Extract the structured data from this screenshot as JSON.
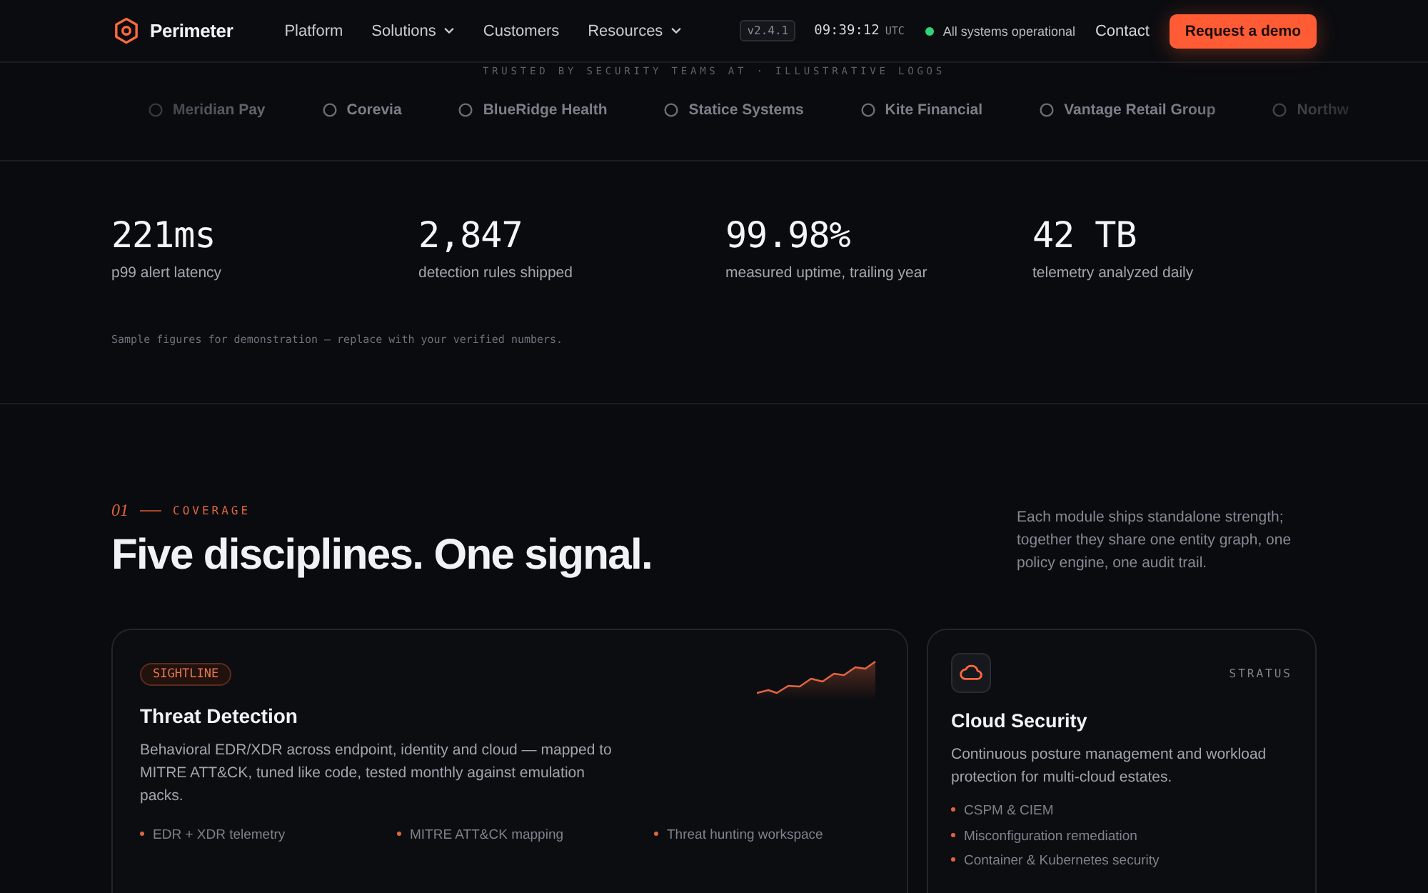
{
  "nav": {
    "brand": "Perimeter",
    "links": [
      {
        "label": "Platform",
        "has_menu": false
      },
      {
        "label": "Solutions",
        "has_menu": true
      },
      {
        "label": "Customers",
        "has_menu": false
      },
      {
        "label": "Resources",
        "has_menu": true
      }
    ],
    "version": "v2.4.1",
    "clock": {
      "time": "09:39:12",
      "zone": "UTC"
    },
    "status": {
      "label": "All systems operational",
      "ok": true
    },
    "contact": "Contact",
    "cta": "Request a demo"
  },
  "logos": {
    "caption": "TRUSTED BY SECURITY TEAMS AT · ILLUSTRATIVE LOGOS",
    "items": [
      "Meridian Pay",
      "Corevia",
      "BlueRidge Health",
      "Statice Systems",
      "Kite Financial",
      "Vantage Retail Group",
      "Northw"
    ]
  },
  "stats": {
    "items": [
      {
        "value": "221ms",
        "label": "p99 alert latency"
      },
      {
        "value": "2,847",
        "label": "detection rules shipped"
      },
      {
        "value": "99.98%",
        "label": "measured uptime, trailing year"
      },
      {
        "value": "42 TB",
        "label": "telemetry analyzed daily"
      }
    ],
    "note": "Sample figures for demonstration — replace with your verified numbers."
  },
  "coverage": {
    "index": "01",
    "eyebrow": "COVERAGE",
    "heading": "Five disciplines. One signal.",
    "intro": "Each module ships standalone strength; together they share one entity graph, one policy engine, one audit trail.",
    "cards": [
      {
        "kind": "feature",
        "badge": "SIGHTLINE",
        "title": "Threat Detection",
        "description": "Behavioral EDR/XDR across endpoint, identity and cloud — mapped to MITRE ATT&CK, tuned like code, tested monthly against emulation packs.",
        "bullets": [
          "EDR + XDR telemetry",
          "MITRE ATT&CK mapping",
          "Threat hunting workspace"
        ]
      },
      {
        "kind": "module",
        "badge": "STRATUS",
        "title": "Cloud Security",
        "description": "Continuous posture management and workload protection for multi-cloud estates.",
        "bullets": [
          "CSPM & CIEM",
          "Misconfiguration remediation",
          "Container & Kubernetes security"
        ]
      }
    ]
  }
}
